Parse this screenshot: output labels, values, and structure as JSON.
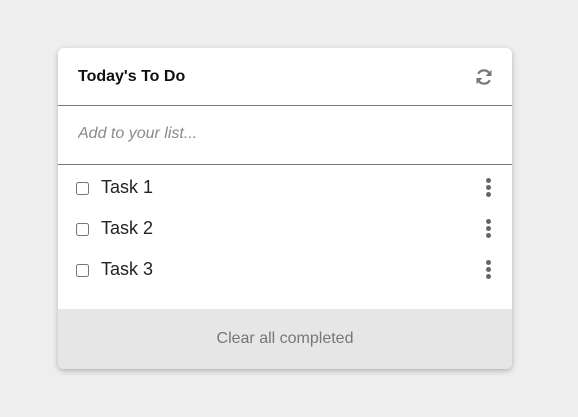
{
  "header": {
    "title": "Today's To Do",
    "refresh_icon": "refresh-icon"
  },
  "new_task": {
    "placeholder": "Add to your list...",
    "value": ""
  },
  "tasks": [
    {
      "label": "Task 1",
      "completed": false,
      "menu_icon": "more-vertical-icon"
    },
    {
      "label": "Task 2",
      "completed": false,
      "menu_icon": "more-vertical-icon"
    },
    {
      "label": "Task 3",
      "completed": false,
      "menu_icon": "more-vertical-icon"
    }
  ],
  "footer": {
    "clear_label": "Clear all completed"
  },
  "colors": {
    "background": "#eeeeee",
    "card": "#ffffff",
    "footer": "#e6e6e6",
    "divider": "#777777",
    "icon": "#666666"
  }
}
